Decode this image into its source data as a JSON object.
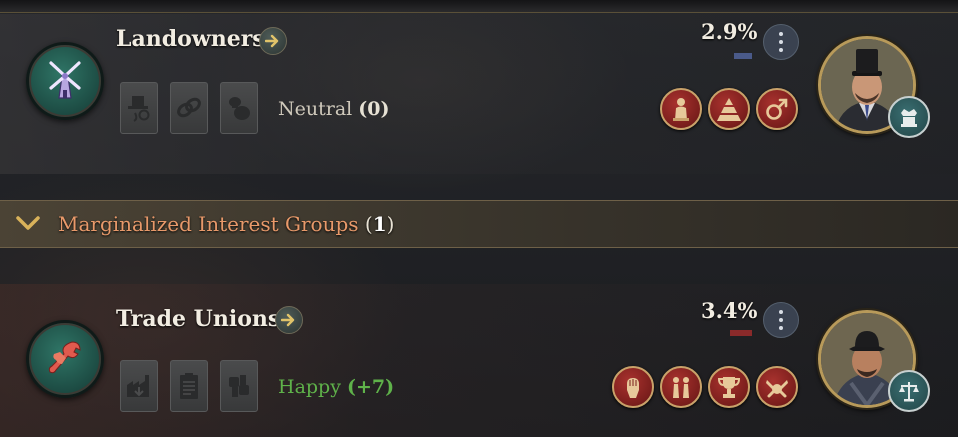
{
  "interest_groups": [
    {
      "name": "Landowners",
      "clout": "2.9%",
      "clout_color": "#4a5a8a",
      "approval_label": "Neutral",
      "approval_value": "(0)",
      "emblem_icon": "windmill-icon",
      "traits": [
        "top-hat-monocle-icon",
        "chain-links-icon",
        "money-bags-icon"
      ],
      "ideologies": [
        "statue-icon",
        "pyramid-hierarchy-icon",
        "gender-symbol-icon"
      ],
      "leader_icon": "landowner-leader-portrait",
      "leader_badge_icon": "throne-crown-icon"
    },
    {
      "name": "Trade Unions",
      "clout": "3.4%",
      "clout_color": "#8a2a2a",
      "approval_label": "Happy",
      "approval_value": "(+7)",
      "emblem_icon": "raised-fist-wrench-icon",
      "traits": [
        "factory-down-icon",
        "clipboard-icon",
        "clasped-fists-icon"
      ],
      "ideologies": [
        "raised-fist-icon",
        "chess-pieces-icon",
        "trophy-cup-icon",
        "linked-fists-icon"
      ],
      "leader_icon": "union-leader-portrait",
      "leader_badge_icon": "scales-of-justice-icon"
    }
  ],
  "marginalized": {
    "label": "Marginalized Interest Groups",
    "count_open": "(",
    "count": "1",
    "count_close": ")"
  },
  "colors": {
    "accent_gold": "#b89a5a",
    "happy_green": "#5fb24a",
    "marginalized_orange": "#e8996a"
  }
}
